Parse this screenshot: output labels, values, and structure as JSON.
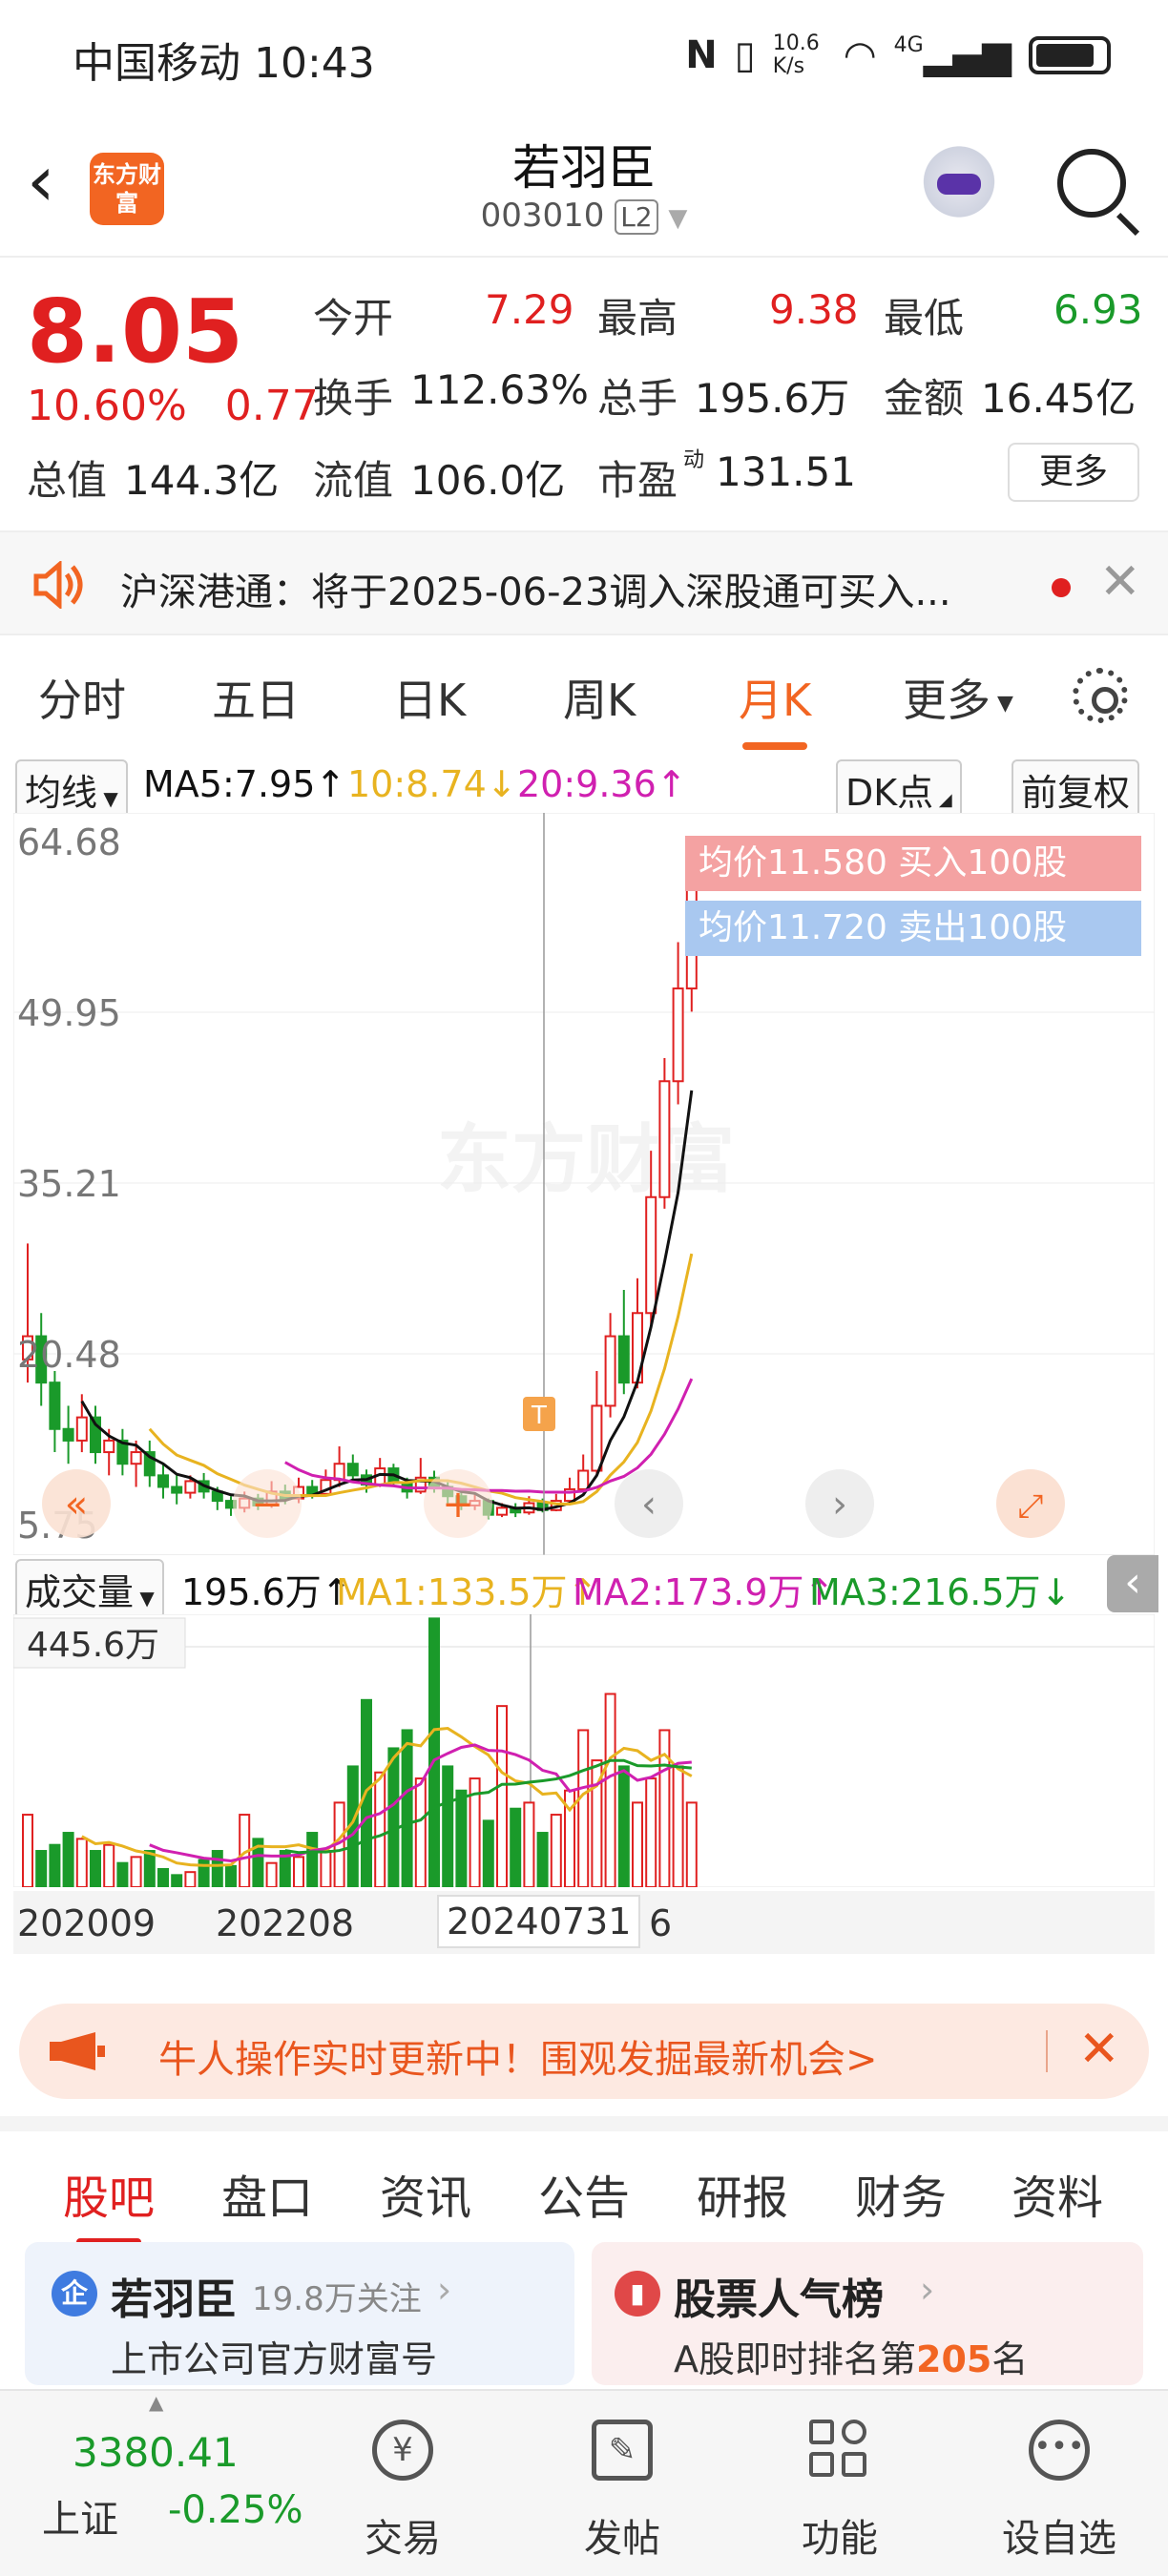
{
  "status_bar": {
    "carrier_time": "中国移动 10:43",
    "net_speed": "10.6 K/s",
    "signal": "4G"
  },
  "header": {
    "logo_text": "东方财富",
    "stock_name": "若羽臣",
    "stock_code": "003010",
    "level_badge": "L2"
  },
  "quote": {
    "price": "8.05",
    "change_pct": "10.60%",
    "change_amt": "0.77",
    "total_mv_label": "总值",
    "total_mv": "144.3亿",
    "open_label": "今开",
    "open": "7.29",
    "high_label": "最高",
    "high": "9.38",
    "low_label": "最低",
    "low": "6.93",
    "turnover_label": "换手",
    "turnover": "112.63%",
    "volume_label": "总手",
    "volume": "195.6万",
    "amount_label": "金额",
    "amount": "16.45亿",
    "float_mv_label": "流值",
    "float_mv": "106.0亿",
    "pe_label": "市盈",
    "pe_sup": "动",
    "pe": "131.51",
    "more_label": "更多"
  },
  "notice": {
    "text": "沪深港通：将于2025-06-23调入深股通可买入..."
  },
  "kline_tabs": [
    "分时",
    "五日",
    "日K",
    "周K",
    "月K",
    "更多"
  ],
  "active_kline_tab": "月K",
  "ma_legend": {
    "selector": "均线",
    "ma5": "MA5:7.95",
    "ma10": "10:8.74",
    "ma20": "20:9.36",
    "dk": "DK点",
    "adjust": "前复权"
  },
  "price_axis": [
    "64.68",
    "49.95",
    "35.21",
    "20.48",
    "5.75"
  ],
  "overlay": {
    "buy": "均价11.580  买入100股",
    "sell": "均价11.720  卖出100股",
    "watermark": "东方财富",
    "marker": "T"
  },
  "volume_legend": {
    "selector": "成交量",
    "vol": "195.6万",
    "ma1": "MA1:133.5万",
    "ma2": "MA2:173.9万",
    "ma3": "MA3:216.5万",
    "max": "445.6万"
  },
  "date_axis": [
    "202009",
    "202208",
    "20240731",
    "6"
  ],
  "colors": {
    "up": "#e02020",
    "down": "#1a9a2a",
    "accent": "#f26522",
    "ma5": "#111111",
    "ma10": "#e8b320",
    "ma20": "#d020b0",
    "vma": "#1a9a2a"
  },
  "promo": {
    "text": "牛人操作实时更新中！围观发掘最新机会>"
  },
  "bottom_tabs": [
    "股吧",
    "盘口",
    "资讯",
    "公告",
    "研报",
    "财务",
    "资料"
  ],
  "active_bottom_tab": "股吧",
  "cards": {
    "left": {
      "icon": "企",
      "title": "若羽臣",
      "followers": "19.8万关注",
      "subtitle": "上市公司官方财富号"
    },
    "right": {
      "title": "股票人气榜",
      "sub_prefix": "A股即时排名第",
      "rank": "205",
      "sub_suffix": "名"
    }
  },
  "bottom_nav": {
    "index_value": "3380.41",
    "index_name": "上证",
    "index_change": "-0.25%",
    "items": [
      "交易",
      "发帖",
      "功能",
      "设自选"
    ]
  },
  "chart_data": {
    "type": "candlestick",
    "period": "monthly",
    "ylim": [
      5.75,
      64.68
    ],
    "candles": [
      [
        20,
        22,
        30,
        18
      ],
      [
        22,
        18,
        24,
        16
      ],
      [
        18,
        14,
        19,
        12
      ],
      [
        14,
        13,
        16,
        11
      ],
      [
        13,
        15,
        17,
        12
      ],
      [
        15,
        12,
        16,
        11
      ],
      [
        12,
        13,
        14,
        10
      ],
      [
        13,
        11,
        14,
        10
      ],
      [
        11,
        12,
        13,
        9
      ],
      [
        12,
        10,
        13,
        9
      ],
      [
        10,
        9,
        11,
        8
      ],
      [
        9,
        8.5,
        10,
        7.5
      ],
      [
        8.5,
        9.5,
        10,
        8
      ],
      [
        9.5,
        8.6,
        10.2,
        8
      ],
      [
        8.6,
        7.8,
        9,
        7
      ],
      [
        7.8,
        7.2,
        8.2,
        6.5
      ],
      [
        7.2,
        8,
        8.6,
        6.8
      ],
      [
        8,
        7.4,
        8.4,
        7
      ],
      [
        7.4,
        8.6,
        9.5,
        7.2
      ],
      [
        8.6,
        8,
        9.2,
        7.5
      ],
      [
        8,
        9,
        9.8,
        7.6
      ],
      [
        9,
        8.4,
        9.6,
        8
      ],
      [
        8.4,
        9.6,
        10.5,
        8.2
      ],
      [
        9.6,
        11,
        12.5,
        9
      ],
      [
        11,
        10,
        11.8,
        9.5
      ],
      [
        10,
        9.2,
        10.5,
        8.5
      ],
      [
        9.2,
        10.6,
        11.5,
        9
      ],
      [
        10.6,
        9.4,
        11,
        9
      ],
      [
        9.4,
        8.6,
        9.8,
        8
      ],
      [
        8.6,
        9.8,
        11.5,
        8.4
      ],
      [
        9.8,
        9,
        10.4,
        8.5
      ],
      [
        9,
        8.2,
        9.4,
        7.6
      ],
      [
        8.2,
        7.4,
        8.6,
        7
      ],
      [
        7.4,
        7.8,
        8.4,
        7
      ],
      [
        7.8,
        6.6,
        8,
        6.2
      ],
      [
        6.6,
        7.2,
        7.6,
        6.4
      ],
      [
        7.2,
        6.8,
        7.6,
        6.4
      ],
      [
        6.8,
        7.6,
        8.2,
        6.6
      ],
      [
        7.6,
        7,
        8,
        6.8
      ],
      [
        7,
        7.8,
        8.4,
        6.9
      ],
      [
        7.8,
        8.8,
        9.8,
        7.6
      ],
      [
        8.8,
        10.4,
        11.8,
        8.6
      ],
      [
        10.4,
        16,
        19,
        10
      ],
      [
        16,
        22,
        24,
        15
      ],
      [
        22,
        18,
        26,
        17
      ],
      [
        18,
        24,
        27,
        17.5
      ],
      [
        24,
        34,
        38,
        23
      ],
      [
        34,
        44,
        46,
        33
      ],
      [
        44,
        52,
        56,
        42
      ],
      [
        52,
        62,
        64.68,
        50
      ]
    ],
    "volume_ylim": [
      0,
      445.6
    ],
    "volumes": [
      120,
      60,
      70,
      90,
      80,
      60,
      70,
      40,
      50,
      60,
      30,
      20,
      25,
      45,
      60,
      35,
      120,
      80,
      40,
      60,
      50,
      90,
      60,
      140,
      200,
      310,
      190,
      230,
      260,
      180,
      445,
      200,
      160,
      180,
      110,
      300,
      130,
      140,
      90,
      120,
      160,
      260,
      210,
      320,
      200,
      140,
      180,
      260,
      200,
      140
    ]
  }
}
